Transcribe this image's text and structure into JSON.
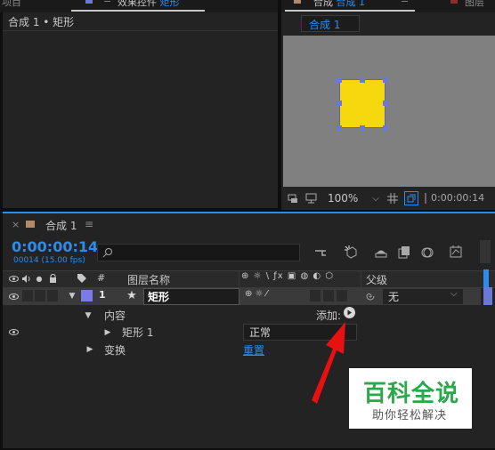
{
  "effect_controls": {
    "tab_left_label": "项目",
    "tab_label_prefix": "效果控件",
    "tab_label_layer": "矩形",
    "breadcrumb": "合成 1 • 矩形"
  },
  "composition_viewer": {
    "tab_label_prefix": "合成",
    "tab_label_comp": "合成 1",
    "tab_right_label": "图层",
    "comp_tab": "合成 1",
    "zoom": "100%",
    "timecode": "0:00:00:14",
    "shape_color": "#f5d80e",
    "bg_color": "#808080"
  },
  "timeline": {
    "comp_tab": "合成 1",
    "timecode": "0:00:00:14",
    "frame_info": "00014 (15.00 fps)",
    "search_placeholder": "",
    "columns": {
      "number": "#",
      "layer_name": "图层名称",
      "parent": "父级"
    },
    "layer": {
      "index": "1",
      "name": "矩形",
      "parent_value": "无",
      "label_color": "#7a7ae8"
    },
    "contents_label": "内容",
    "add_label": "添加:",
    "rect_group_label": "矩形 1",
    "blend_mode": "正常",
    "transform_label": "变换",
    "reset_label": "重置"
  },
  "watermark": {
    "title": "百科全说",
    "subtitle": "助你轻松解决"
  }
}
